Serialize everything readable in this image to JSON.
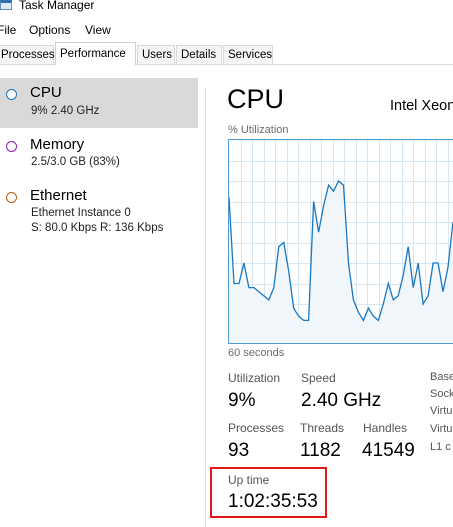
{
  "window": {
    "title": "Task Manager"
  },
  "menu": [
    "File",
    "Options",
    "View"
  ],
  "tabs": [
    "Processes",
    "Performance",
    "Users",
    "Details",
    "Services"
  ],
  "active_tab": "Performance",
  "sidebar": {
    "items": [
      {
        "title": "CPU",
        "sub": "9% 2.40 GHz",
        "color": "#1a78c2",
        "selected": true
      },
      {
        "title": "Memory",
        "sub": "2.5/3.0 GB (83%)",
        "color": "#8b1ec4",
        "selected": false
      },
      {
        "title": "Ethernet",
        "sub": "Ethernet Instance 0",
        "sub2": "S: 80.0 Kbps  R: 136 Kbps",
        "color": "#b85a0e",
        "selected": false
      }
    ]
  },
  "main": {
    "title": "CPU",
    "model": "Intel Xeon",
    "graph_label": "% Utilization",
    "graph_time": "60 seconds",
    "graph_line_color": "#1a78c2",
    "graph_fill_color": "#f1f6fb",
    "graph_grid_color": "#d6e6f3",
    "utilization_history": [
      72,
      30,
      30,
      40,
      28,
      28,
      26,
      24,
      22,
      28,
      48,
      50,
      36,
      18,
      14,
      12,
      12,
      70,
      55,
      68,
      78,
      75,
      80,
      78,
      40,
      22,
      16,
      12,
      18,
      14,
      12,
      20,
      30,
      22,
      24,
      34,
      48,
      28,
      40,
      20,
      24,
      40,
      40,
      26,
      38,
      60
    ],
    "stats": {
      "utilization_label": "Utilization",
      "utilization": "9%",
      "speed_label": "Speed",
      "speed": "2.40 GHz",
      "processes_label": "Processes",
      "processes": "93",
      "threads_label": "Threads",
      "threads": "1182",
      "handles_label": "Handles",
      "handles": "41549",
      "uptime_label": "Up time",
      "uptime": "1:02:35:53"
    },
    "right_labels": [
      "Base",
      "Sock",
      "Virtu",
      "Virtu",
      "L1 c"
    ]
  },
  "highlight_color": "#e01818"
}
